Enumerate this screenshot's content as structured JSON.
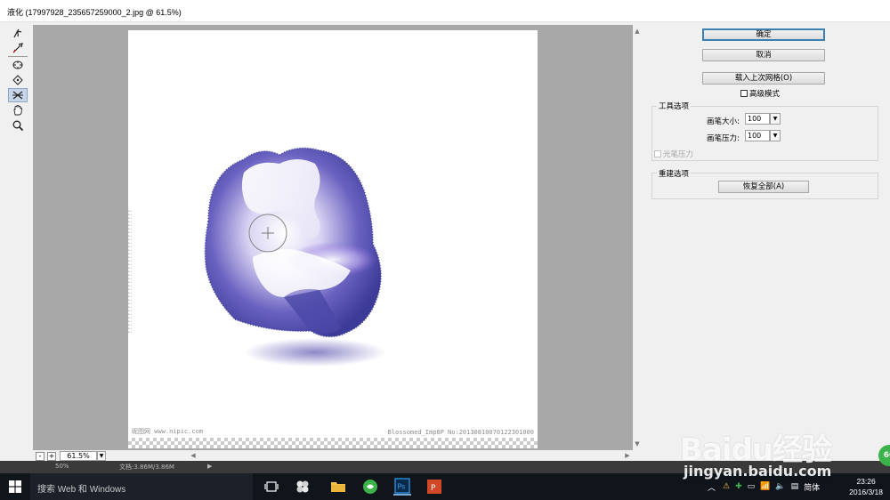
{
  "window": {
    "title": "液化 (17997928_235657259000_2.jpg @ 61.5%)"
  },
  "toolbar": {
    "tools": [
      "forward-warp-tool",
      "reconstruct-tool",
      "pucker-tool",
      "bloat-tool",
      "push-left-tool",
      "hand-tool",
      "zoom-tool"
    ]
  },
  "canvas": {
    "watermark_left": "昵图网 www.nipic.com",
    "watermark_right": "Blossomed_Imp8P No:20130810070122301000"
  },
  "zoom": {
    "minus": "-",
    "plus": "+",
    "value": "61.5%"
  },
  "panel": {
    "ok_label": "确定",
    "cancel_label": "取消",
    "load_mesh_label": "载入上次网格(O)",
    "advanced_mode_label": "高级模式",
    "tool_options": {
      "title": "工具选项",
      "brush_size_label": "画笔大小:",
      "brush_size_value": "100",
      "brush_pressure_label": "画笔压力:",
      "brush_pressure_value": "100",
      "stylus_pressure_label": "光笔压力"
    },
    "reconstruct_options": {
      "title": "重建选项",
      "restore_all_label": "恢复全部(A)"
    }
  },
  "statusbar": {
    "zoom": "50%",
    "doc": "文档:3.86M/3.86M"
  },
  "taskbar": {
    "search_placeholder": "搜索 Web 和 Windows",
    "ime": "简体",
    "time": "23:26",
    "date": "2016/3/18"
  },
  "overlay": {
    "logo": "Baidu经验",
    "url": "jingyan.baidu.com",
    "badge": "60"
  },
  "colors": {
    "accent": "#3c7fb1",
    "sphere_blue": "#4a4aa8",
    "sphere_purple": "#a898e0"
  }
}
